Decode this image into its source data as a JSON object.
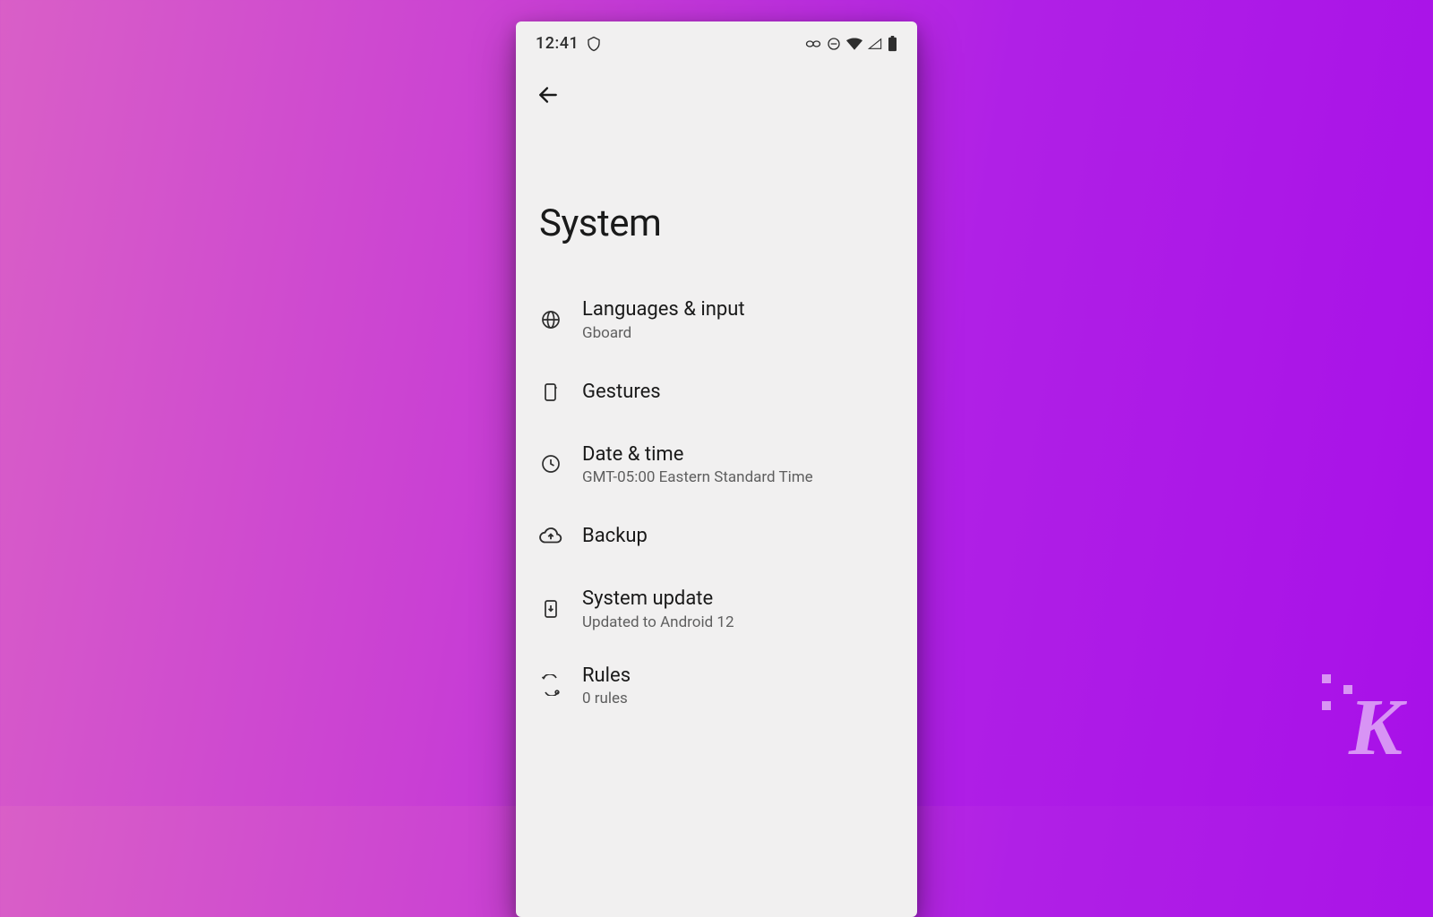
{
  "statusbar": {
    "time": "12:41"
  },
  "header": {
    "title": "System"
  },
  "items": [
    {
      "title": "Languages & input",
      "subtitle": "Gboard"
    },
    {
      "title": "Gestures",
      "subtitle": ""
    },
    {
      "title": "Date & time",
      "subtitle": "GMT-05:00 Eastern Standard Time"
    },
    {
      "title": "Backup",
      "subtitle": ""
    },
    {
      "title": "System update",
      "subtitle": "Updated to Android 12"
    },
    {
      "title": "Rules",
      "subtitle": "0 rules"
    }
  ],
  "watermark": {
    "letter": "K"
  }
}
